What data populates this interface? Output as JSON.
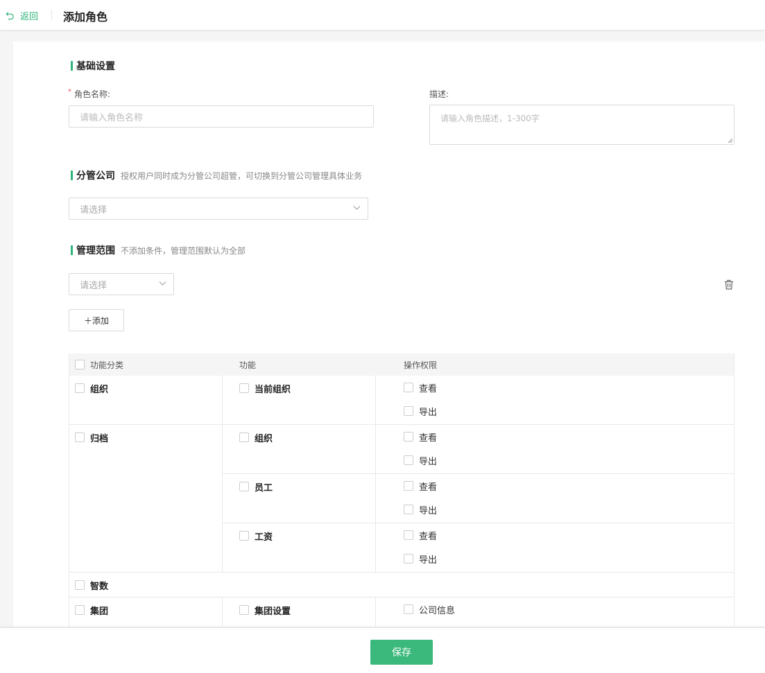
{
  "header": {
    "back_label": "返回",
    "title": "添加角色"
  },
  "basic": {
    "title": "基础设置",
    "name_label": "角色名称:",
    "name_required": "*",
    "name_placeholder": "请输入角色名称",
    "desc_label": "描述:",
    "desc_placeholder": "请输入角色描述，1-300字"
  },
  "company": {
    "title": "分管公司",
    "hint": "授权用户同时成为分管公司超管，可切换到分管公司管理具体业务",
    "select_placeholder": "请选择"
  },
  "scope": {
    "title": "管理范围",
    "hint": "不添加条件，管理范围默认为全部",
    "select_placeholder": "请选择",
    "add_label": "＋添加"
  },
  "table": {
    "headers": [
      "功能分类",
      "功能",
      "操作权限"
    ],
    "rows": [
      {
        "category": "组织",
        "functions": [
          {
            "name": "当前组织",
            "perms": [
              "查看",
              "导出"
            ]
          }
        ]
      },
      {
        "category": "归档",
        "functions": [
          {
            "name": "组织",
            "perms": [
              "查看",
              "导出"
            ]
          },
          {
            "name": "员工",
            "perms": [
              "查看",
              "导出"
            ]
          },
          {
            "name": "工资",
            "perms": [
              "查看",
              "导出"
            ]
          }
        ]
      },
      {
        "category": "智数",
        "functions": []
      },
      {
        "category": "集团",
        "functions": [
          {
            "name": "集团设置",
            "perms": [
              "公司信息"
            ]
          }
        ]
      }
    ]
  },
  "footer": {
    "save_label": "保存"
  },
  "colors": {
    "accent": "#2fb37a",
    "save_button": "#3bb87b"
  }
}
